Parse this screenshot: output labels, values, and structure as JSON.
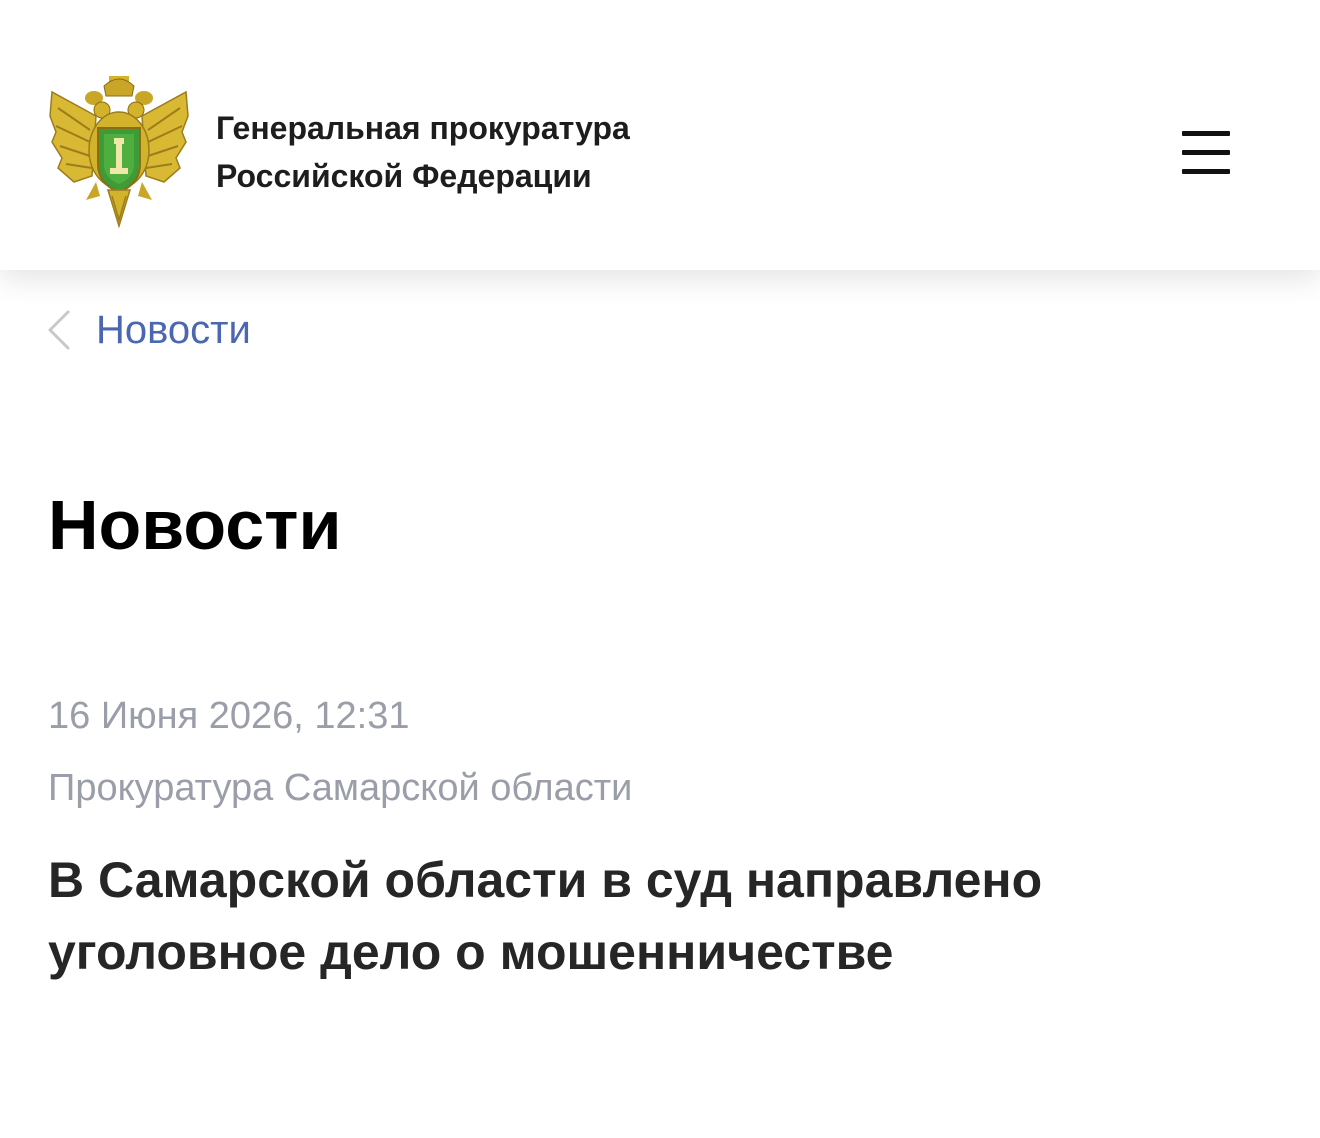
{
  "header": {
    "org_line1": "Генеральная прокуратура",
    "org_line2": "Российской Федерации",
    "emblem_icon": "prosecutor-emblem-icon",
    "menu_icon": "hamburger-menu-icon"
  },
  "breadcrumb": {
    "back_icon": "chevron-left-icon",
    "label": "Новости"
  },
  "page": {
    "title": "Новости"
  },
  "article": {
    "date": "16 Июня 2026, 12:31",
    "source": "Прокуратура Самарской области",
    "title": "В Самарской области в суд направлено уголовное дело о мошенничестве"
  },
  "colors": {
    "link": "#4a67b0",
    "meta_text": "#9a9ea8",
    "emblem_gold": "#d4b32c",
    "emblem_green": "#3f9b35"
  }
}
